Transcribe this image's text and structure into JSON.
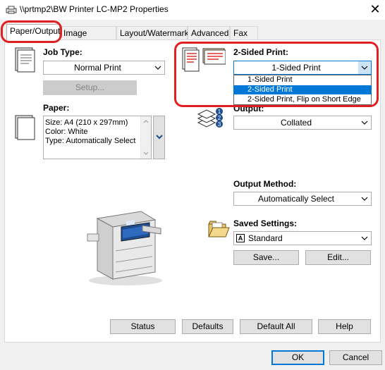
{
  "window": {
    "title": "\\\\prtmp2\\BW Printer LC-MP2 Properties",
    "close_glyph": "✕"
  },
  "tabs": [
    {
      "label": "Paper/Output"
    },
    {
      "label": "Image Options"
    },
    {
      "label": "Layout/Watermark"
    },
    {
      "label": "Advanced"
    },
    {
      "label": "Fax"
    }
  ],
  "job_type": {
    "label": "Job Type:",
    "value": "Normal Print",
    "setup_label": "Setup..."
  },
  "paper": {
    "label": "Paper:",
    "lines": [
      "Size: A4 (210 x 297mm)",
      "Color: White",
      "Type: Automatically Select"
    ]
  },
  "two_sided": {
    "label": "2-Sided Print:",
    "value": "1-Sided Print",
    "options": [
      "1-Sided Print",
      "2-Sided Print",
      "2-Sided Print, Flip on Short Edge"
    ],
    "highlighted_option": "2-Sided Print"
  },
  "output": {
    "label": "Output:",
    "value": "Collated",
    "icon_numbers": [
      "1",
      "2",
      "3"
    ]
  },
  "output_method": {
    "label": "Output Method:",
    "value": "Automatically Select"
  },
  "saved_settings": {
    "label": "Saved Settings:",
    "value": "Standard",
    "badge": "A",
    "save_label": "Save...",
    "edit_label": "Edit..."
  },
  "bottom_buttons": {
    "status": "Status",
    "defaults": "Defaults",
    "default_all": "Default All",
    "help": "Help"
  },
  "dialog_buttons": {
    "ok": "OK",
    "cancel": "Cancel"
  },
  "colors": {
    "highlight": "#0078d7",
    "annotation": "#e02020",
    "window_bg": "#f0f0f0"
  }
}
